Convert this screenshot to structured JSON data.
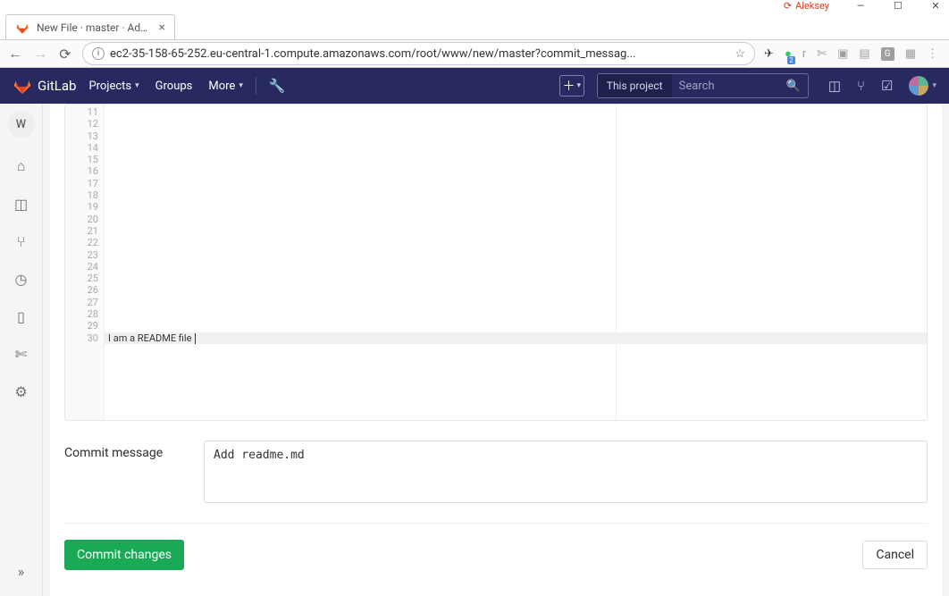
{
  "window": {
    "user_label": "Aleksey",
    "controls": {
      "min": "—",
      "max": "☐",
      "close": "✕"
    }
  },
  "browser": {
    "tab_title": "New File · master · Admin",
    "url": "ec2-35-158-65-252.eu-central-1.compute.amazonaws.com/root/www/new/master?commit_messag...",
    "ext_badge": "2",
    "ext_letter": "r",
    "ext_g": "G"
  },
  "header": {
    "brand": "GitLab",
    "nav": {
      "projects": "Projects",
      "groups": "Groups",
      "more": "More"
    },
    "search_scope": "This project",
    "search_placeholder": "Search"
  },
  "sidebar": {
    "avatar_letter": "W"
  },
  "editor": {
    "line_start": 11,
    "line_end": 30,
    "content_line": 30,
    "content_text": "I am a README file"
  },
  "commit": {
    "label": "Commit message",
    "message": "Add readme.md"
  },
  "actions": {
    "commit": "Commit changes",
    "cancel": "Cancel"
  }
}
